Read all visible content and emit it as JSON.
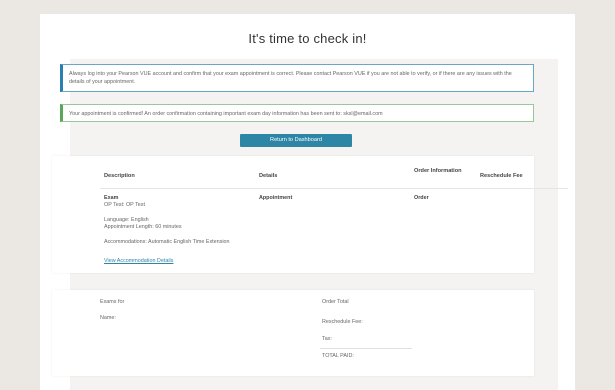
{
  "header": {
    "title": "It's time to check in!"
  },
  "alerts": {
    "info_text": "Always log into your Pearson VUE account and confirm that your exam appointment is correct. Please contact Pearson VUE if you are not able to verify, or if there are any issues with the details of your appointment.",
    "success_text": "Your appointment is confirmed! An order confirmation containing important exam day information has been sent to: sksl@email.com"
  },
  "actions": {
    "return_label": "Return to Dashboard"
  },
  "table": {
    "headers": {
      "description": "Description",
      "details": "Details",
      "order_info": "Order Information",
      "reschedule_fee": "Reschedule Fee"
    },
    "row": {
      "item_label": "Exam",
      "exam_name": "OP Test: OP Test",
      "language": "Language: English",
      "length": "Appointment Length: 60 minutes",
      "accommodations": "Accommodations: Automatic English Time Extension",
      "accommodation_link": "View Accommodation Details",
      "details_value": "Appointment",
      "order_value": "Order"
    }
  },
  "summary": {
    "exams_for": "Exams for",
    "name": "Name:",
    "order_total": "Order Total",
    "reschedule_fee": "Reschedule Fee:",
    "tax": "Tax:",
    "total_paid": "TOTAL PAID:"
  },
  "colors": {
    "page_bg": "#ebe8e4",
    "accent": "#2e86a6",
    "info_border": "#2b7fb0",
    "success_border": "#5aa65a"
  }
}
